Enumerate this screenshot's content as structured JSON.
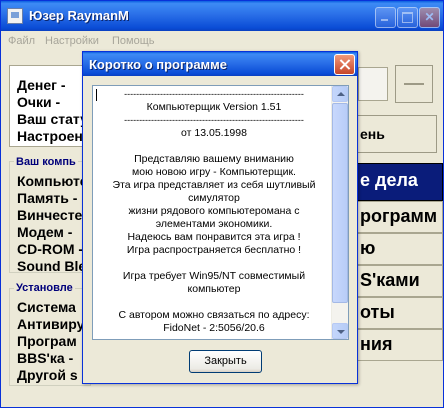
{
  "main_window": {
    "title": "Юзер RaymanM",
    "title_buttons": [
      "minimize",
      "maximize",
      "close"
    ]
  },
  "menu": [
    "Файл",
    "Настройки",
    "Помощь"
  ],
  "stats_panel": {
    "labels": [
      "Денег -",
      "Очки -",
      "Ваш стату",
      "Настроен"
    ]
  },
  "right_button_partial": "ень",
  "computer_group": {
    "title": "Ваш компь",
    "items": [
      "Компьюте",
      "Память -",
      "Винчесте",
      "Модем -",
      "CD-ROM -",
      "Sound Ble"
    ]
  },
  "installed_group": {
    "title": "Установле",
    "items": [
      "Система",
      "Антивиру",
      "Програм",
      "BBS'ка -",
      "Другой s"
    ]
  },
  "right_buttons": [
    "е дела",
    "рограмм",
    "ю",
    "S'ками",
    "оты",
    "ния"
  ],
  "dialog": {
    "title": "Коротко о программе",
    "memo_lines": [
      "------------------------------------------------------------",
      "Компьютерщик   Version 1.51",
      "------------------------------------------------------------",
      "от 13.05.1998",
      "",
      "Представляю вашему вниманию",
      "мою новою игру  -  Компьютерщик.",
      "Эта игра представляет из себя шутливый",
      "симулятор",
      "жизни рядового компьютеромана с",
      "элементами экономики.",
      "Надеюсь вам понравится эта игра !",
      "Игра распространяется бесплатно !",
      "",
      "Игра требует Win95/NT совместимый",
      "компьютер",
      "",
      "С автором можно связаться по адресу:",
      "FidoNet -   2:5056/20.6"
    ],
    "close_button": "Закрыть"
  }
}
